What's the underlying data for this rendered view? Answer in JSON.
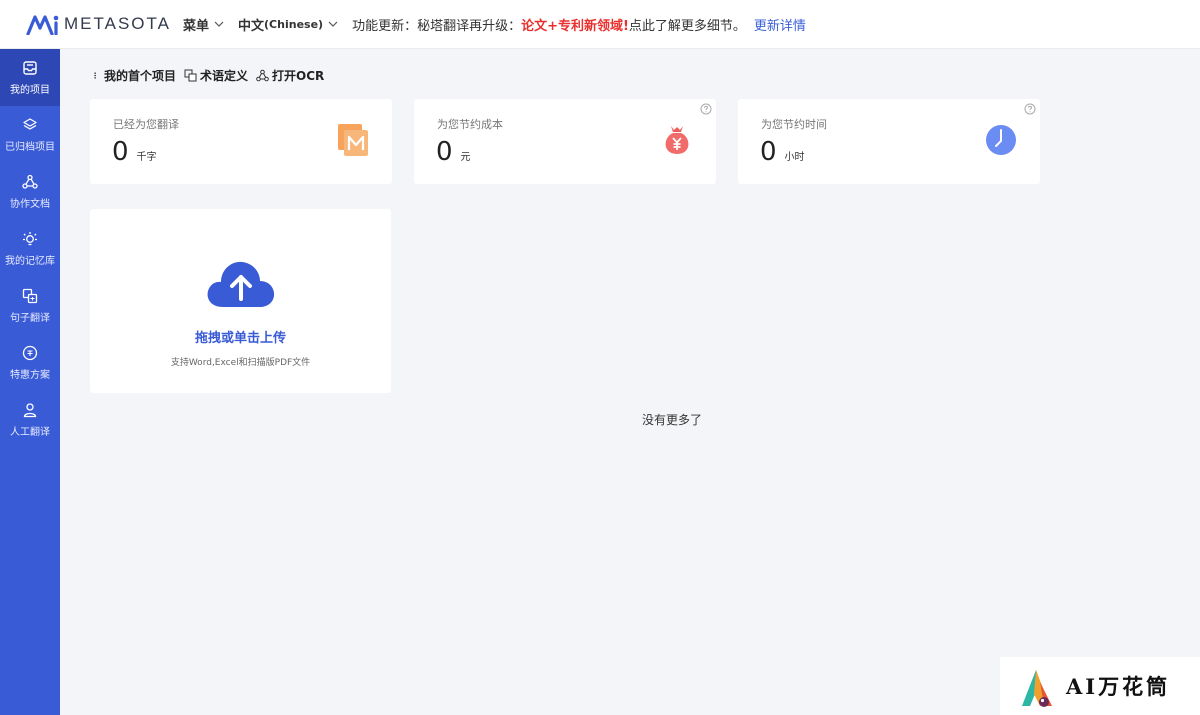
{
  "brand": {
    "name": "METASOTA",
    "accent": "#3a5bd6"
  },
  "topnav": {
    "menu_label": "菜单",
    "lang_label": "中文",
    "lang_sub": "(Chinese)",
    "notice_prefix": "功能更新：秘塔翻译再升级：",
    "notice_highlight": "论文+专利新领域!",
    "notice_suffix": "点此了解更多细节。",
    "notice_link": "更新详情"
  },
  "sidebar": {
    "items": [
      {
        "label": "我的项目",
        "icon": "inbox-icon"
      },
      {
        "label": "已归档项目",
        "icon": "layers-icon"
      },
      {
        "label": "协作文档",
        "icon": "share-icon"
      },
      {
        "label": "我的记忆库",
        "icon": "bulb-icon"
      },
      {
        "label": "句子翻译",
        "icon": "translate-icon"
      },
      {
        "label": "特惠方案",
        "icon": "discount-icon"
      },
      {
        "label": "人工翻译",
        "icon": "person-icon"
      }
    ]
  },
  "crumbs": {
    "project": "我的首个项目",
    "glossary": "术语定义",
    "ocr": "打开OCR"
  },
  "stats": [
    {
      "label": "已经为您翻译",
      "value": "0",
      "unit": "千字",
      "icon": "document-m-icon"
    },
    {
      "label": "为您节约成本",
      "value": "0",
      "unit": "元",
      "icon": "money-bag-icon"
    },
    {
      "label": "为您节约时间",
      "value": "0",
      "unit": "小时",
      "icon": "clock-icon"
    }
  ],
  "upload": {
    "title": "拖拽或单击上传",
    "hint": "支持Word,Excel和扫描版PDF文件"
  },
  "no_more": "没有更多了",
  "watermark": {
    "text": "AI万花筒"
  }
}
